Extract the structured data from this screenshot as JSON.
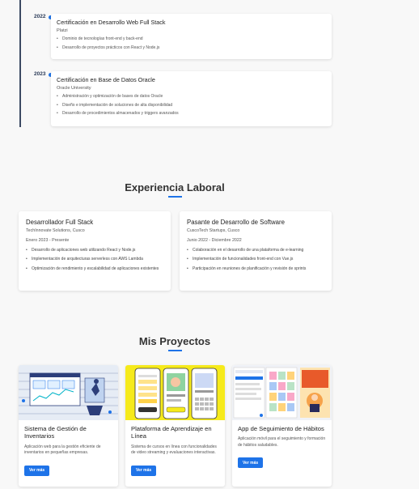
{
  "timeline": {
    "items": [
      {
        "year": "2022",
        "title": "Certificación en Desarrollo Web Full Stack",
        "org": "Platzi",
        "points": [
          "Dominio de tecnologías front-end y back-end",
          "Desarrollo de proyectos prácticos con React y Node.js"
        ]
      },
      {
        "year": "2023",
        "title": "Certificación en Base de Datos Oracle",
        "org": "Oracle University",
        "points": [
          "Administración y optimización de bases de datos Oracle",
          "Diseño e implementación de soluciones de alta disponibilidad",
          "Desarrollo de procedimientos almacenados y triggers avanzados"
        ]
      }
    ]
  },
  "experience": {
    "heading": "Experiencia Laboral",
    "jobs": [
      {
        "title": "Desarrollador Full Stack",
        "company": "TechInnovate Solutions, Cusco",
        "period": "Enero 2023 - Presente",
        "points": [
          "Desarrollo de aplicaciones web utilizando React y Node.js",
          "Implementación de arquitecturas serverless con AWS Lambda",
          "Optimización de rendimiento y escalabilidad de aplicaciones existentes"
        ]
      },
      {
        "title": "Pasante de Desarrollo de Software",
        "company": "CuscoTech Startups, Cusco",
        "period": "Junio 2022 - Diciembre 2022",
        "points": [
          "Colaboración en el desarrollo de una plataforma de e-learning",
          "Implementación de funcionalidades front-end con Vue.js",
          "Participación en reuniones de planificación y revisión de sprints"
        ]
      }
    ]
  },
  "projects": {
    "heading": "Mis Proyectos",
    "items": [
      {
        "title": "Sistema de Gestión de Inventarios",
        "desc": "Aplicación web para la gestión eficiente de inventarios en pequeñas empresas.",
        "button": "Ver más"
      },
      {
        "title": "Plataforma de Aprendizaje en Línea",
        "desc": "Sistema de cursos en línea con funcionalidades de video streaming y evaluaciones interactivas.",
        "button": "Ver más"
      },
      {
        "title": "App de Seguimiento de Hábitos",
        "desc": "Aplicación móvil para el seguimiento y formación de hábitos saludables.",
        "button": "Ver más"
      }
    ]
  },
  "colors": {
    "accent": "#1e73e8",
    "timeline_line": "#3c4a63"
  }
}
